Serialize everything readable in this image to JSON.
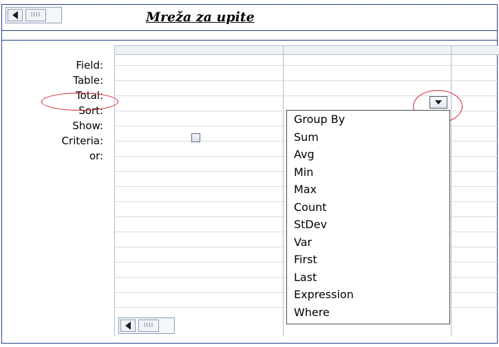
{
  "title": "Mreža za upite",
  "row_labels": [
    "Field:",
    "Table:",
    "Total:",
    "Sort:",
    "Show:",
    "Criteria:",
    "or:"
  ],
  "dropdown": {
    "options": [
      "Group By",
      "Sum",
      "Avg",
      "Min",
      "Max",
      "Count",
      "StDev",
      "Var",
      "First",
      "Last",
      "Expression",
      "Where"
    ]
  },
  "scroll_thumb_glyph": "IIII",
  "colors": {
    "frame_border": "#1c3a8a",
    "annotation_red": "#d61c2c",
    "grid_line": "#b3bccb"
  }
}
